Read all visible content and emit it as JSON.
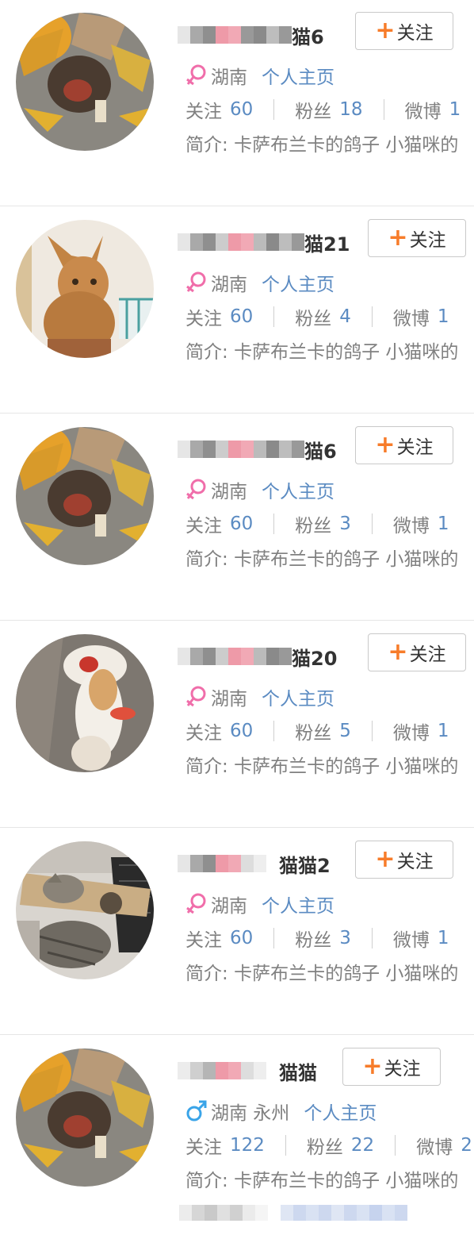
{
  "colors": {
    "link": "#5b8bc2",
    "muted": "#808080",
    "plus": "#f77c2a",
    "female": "#f06eaa",
    "male": "#3aa4e8"
  },
  "follow_label": "关注",
  "follow_plus": "+",
  "homepage_label": "个人主页",
  "stat_labels": {
    "following": "关注",
    "followers": "粉丝",
    "weibo": "微博"
  },
  "bio_label": "简介:",
  "users": [
    {
      "name_suffix": "猫6",
      "gender": "female",
      "location": "湖南",
      "following": "60",
      "followers": "18",
      "weibo": "1",
      "bio": "卡萨布兰卡的鸽子 小猫咪的"
    },
    {
      "name_suffix": "猫21",
      "gender": "female",
      "location": "湖南",
      "following": "60",
      "followers": "4",
      "weibo": "1",
      "bio": "卡萨布兰卡的鸽子 小猫咪的"
    },
    {
      "name_suffix": "猫6",
      "gender": "female",
      "location": "湖南",
      "following": "60",
      "followers": "3",
      "weibo": "1",
      "bio": "卡萨布兰卡的鸽子 小猫咪的"
    },
    {
      "name_suffix": "猫20",
      "gender": "female",
      "location": "湖南",
      "following": "60",
      "followers": "5",
      "weibo": "1",
      "bio": "卡萨布兰卡的鸽子 小猫咪的"
    },
    {
      "name_suffix": "猫猫2",
      "gender": "female",
      "location": "湖南",
      "following": "60",
      "followers": "3",
      "weibo": "1",
      "bio": "卡萨布兰卡的鸽子 小猫咪的"
    },
    {
      "name_suffix": "猫猫",
      "gender": "male",
      "location": "湖南 永州",
      "following": "122",
      "followers": "22",
      "weibo": "2",
      "bio": "卡萨布兰卡的鸽子 小猫咪的"
    }
  ]
}
